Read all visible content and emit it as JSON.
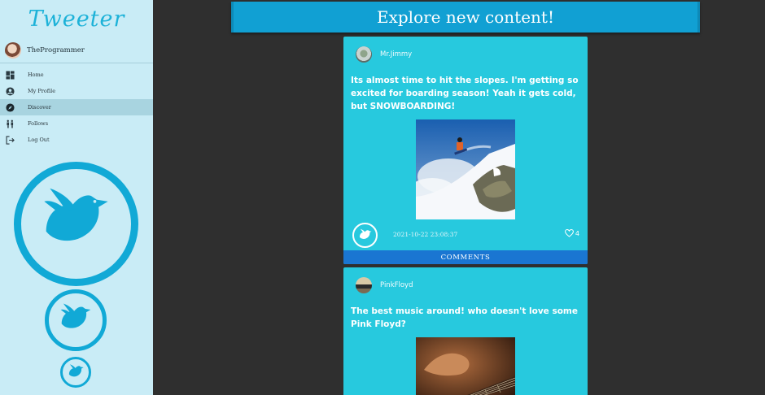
{
  "app": {
    "brand": "Tweeter"
  },
  "sidebar": {
    "user_name": "TheProgrammer",
    "items": [
      {
        "label": "Home",
        "icon": "dashboard-icon"
      },
      {
        "label": "My Profile",
        "icon": "account-circle-icon"
      },
      {
        "label": "Discover",
        "icon": "compass-icon",
        "active": true
      },
      {
        "label": "Follows",
        "icon": "people-icon"
      },
      {
        "label": "Log Out",
        "icon": "logout-icon"
      }
    ]
  },
  "main": {
    "title": "Explore new content!",
    "posts": [
      {
        "user": "Mr.Jimmy",
        "text": "Its almost time to hit the slopes. I'm getting so excited for boarding season! Yeah it gets cold, but SNOWBOARDING!",
        "image": "snowboarder-photo",
        "timestamp": "2021-10-22 23:08:37",
        "likes": "4",
        "comments_label": "COMMENTS"
      },
      {
        "user": "PinkFloyd",
        "text": "The best music around! who doesn't love some Pink Floyd?",
        "image": "guitar-photo"
      }
    ]
  },
  "colors": {
    "accent": "#11a9d6",
    "card": "#27c9de",
    "button": "#1a76d2",
    "sidebar": "#c9ecf6",
    "background": "#2f2f2f"
  }
}
